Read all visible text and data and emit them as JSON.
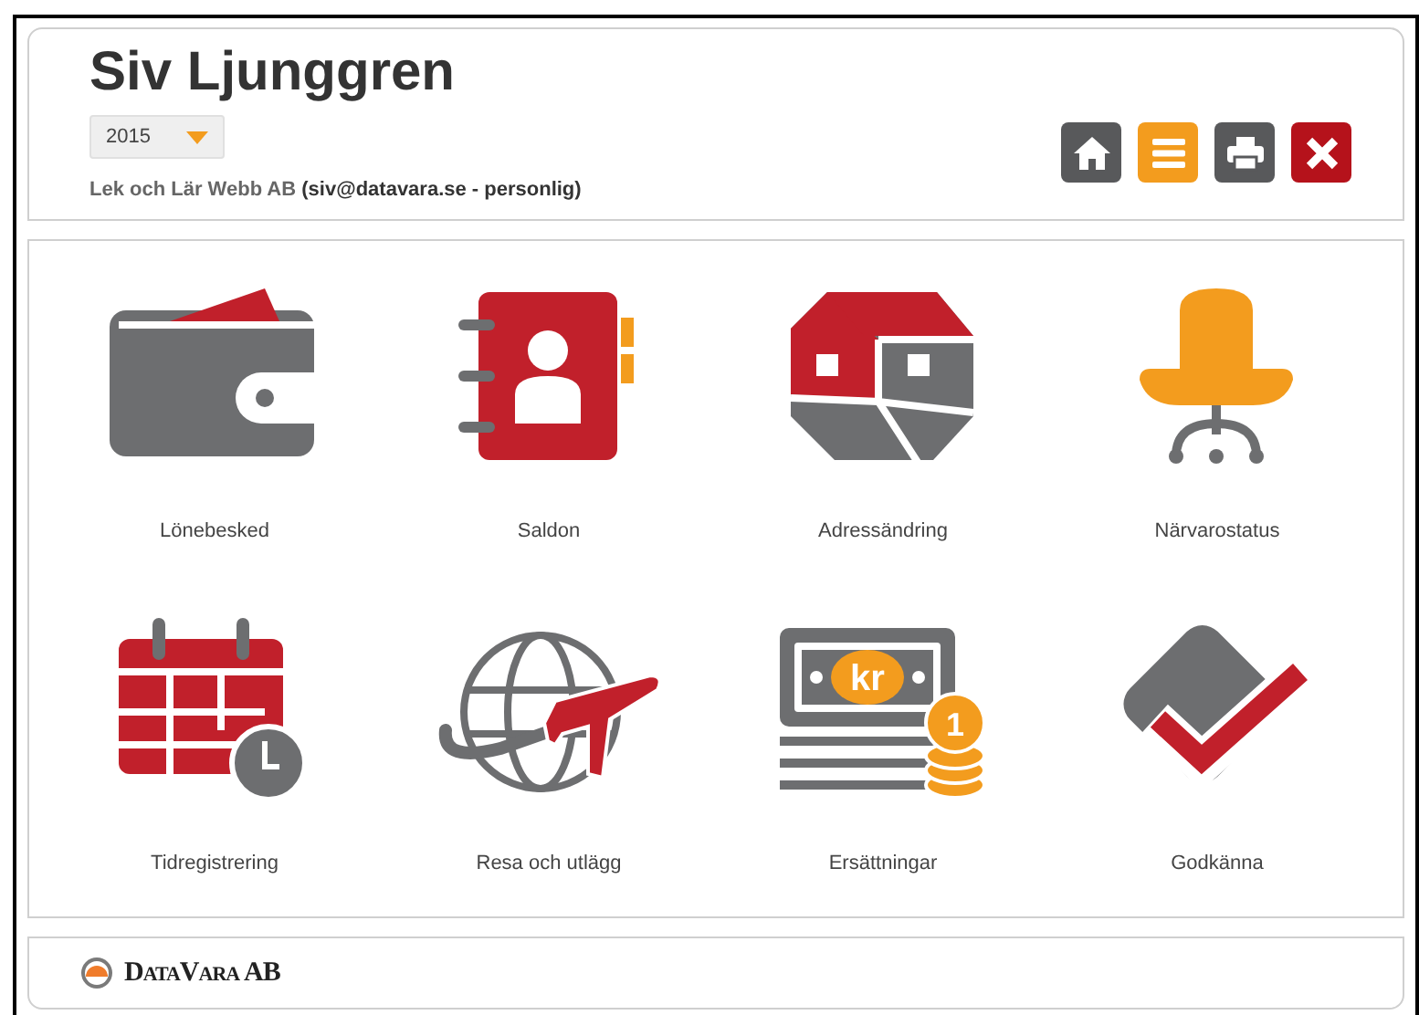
{
  "header": {
    "title": "Siv Ljunggren",
    "year_select": {
      "value": "2015"
    },
    "account": "Lek och Lär Webb AB **(siv@datavara.se - personlig)**"
  },
  "toolbar": [
    {
      "kind": "home",
      "color": "#58595b"
    },
    {
      "kind": "menu",
      "color": "#f39c1e"
    },
    {
      "kind": "print",
      "color": "#58595b"
    },
    {
      "kind": "close",
      "color": "#b5121b"
    }
  ],
  "tiles": [
    {
      "kind": "wallet",
      "label": "Lönebesked"
    },
    {
      "kind": "addressbook",
      "label": "Saldon"
    },
    {
      "kind": "house",
      "label": "Adressändring"
    },
    {
      "kind": "chair",
      "label": "Närvarostatus"
    },
    {
      "kind": "calendar",
      "label": "Tidregistrering"
    },
    {
      "kind": "travel",
      "label": "Resa och utlägg"
    },
    {
      "kind": "money",
      "label": "Ersättningar",
      "note_text": "kr",
      "coin_text": "1"
    },
    {
      "kind": "check",
      "label": "Godkänna"
    }
  ],
  "footer": {
    "logo_text": "DataVara AB"
  }
}
